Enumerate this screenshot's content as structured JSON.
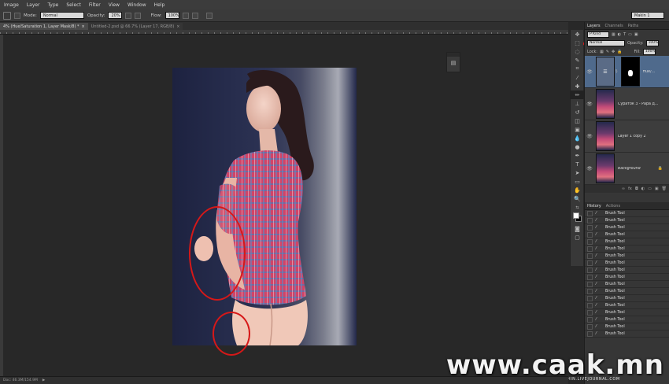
{
  "menu": [
    "Image",
    "Layer",
    "Type",
    "Select",
    "Filter",
    "View",
    "Window",
    "Help"
  ],
  "options": {
    "mode_label": "Mode:",
    "mode_value": "Normal",
    "opacity_label": "Opacity:",
    "opacity_value": "20%",
    "flow_label": "Flow:",
    "flow_value": "100%",
    "workspace_value": "Makin 1"
  },
  "tabs": [
    {
      "label": "4% (Hue/Saturation 1, Layer Mask/8) *",
      "active": true
    },
    {
      "label": "Untitled-2.psd @ 66.7% (Layer 17, RGB/8)",
      "active": false
    }
  ],
  "status": {
    "zoom": "Doc: 46.3M/154.9M"
  },
  "layers_panel": {
    "tabs": [
      "Layers",
      "Channels",
      "Paths"
    ],
    "kind_value": "P Kind",
    "blend_value": "Normal",
    "opacity_label": "Opacity:",
    "opacity_value": "100%",
    "lock_label": "Lock:",
    "fill_label": "Fill:",
    "fill_value": "100%",
    "layers": [
      {
        "name": "Hue/...",
        "type": "adjustment",
        "selected": true
      },
      {
        "name": "Сураток 3 - Рара д...",
        "type": "photo",
        "selected": false
      },
      {
        "name": "Layer 1 copy 2",
        "type": "photo",
        "selected": false
      },
      {
        "name": "Background",
        "type": "photo",
        "selected": false,
        "italic": true,
        "locked": true
      }
    ]
  },
  "history_panel": {
    "tabs": [
      "History",
      "Actions"
    ],
    "item_label": "Brush Tool",
    "count": 18
  },
  "watermark": "www.caak.mn",
  "credit": "LETOHIN.LIVEJOURNAL.COM"
}
